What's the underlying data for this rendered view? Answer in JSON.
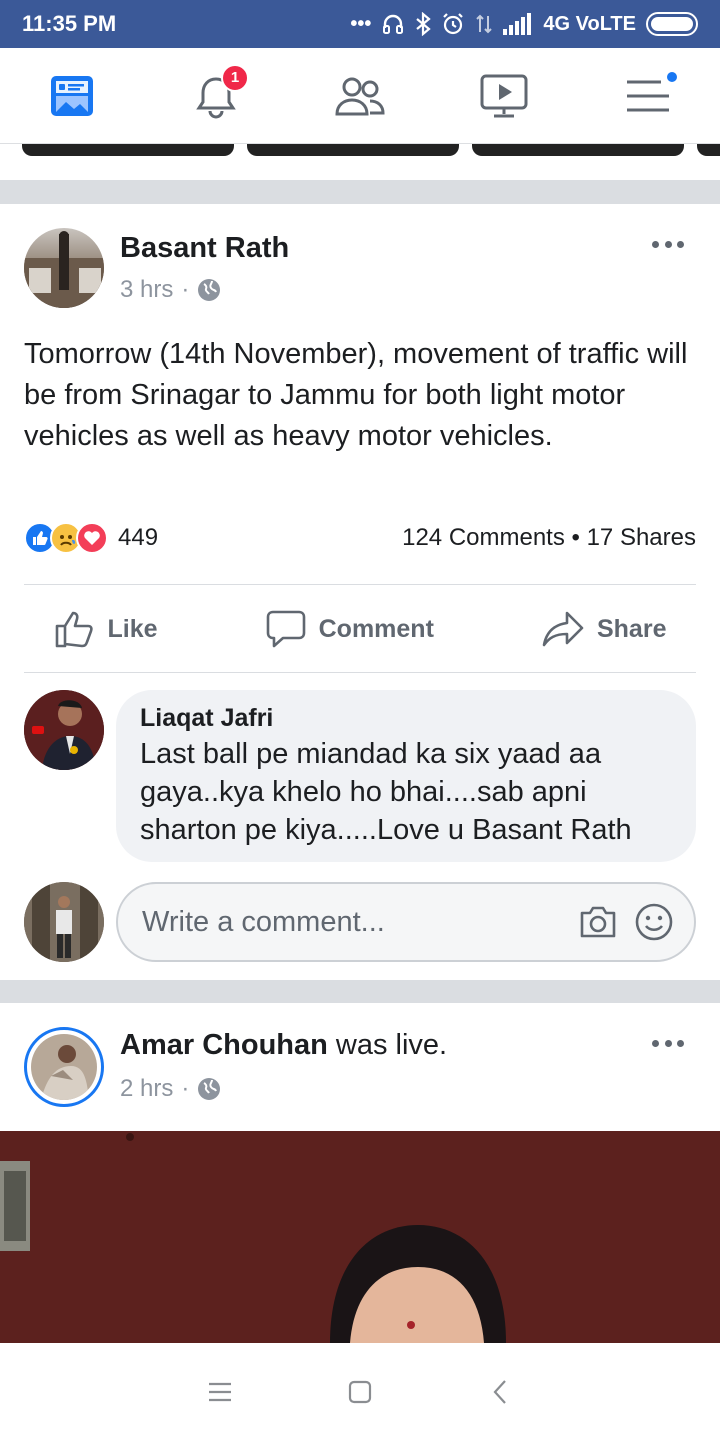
{
  "status_bar": {
    "time": "11:35 PM",
    "network": "4G VoLTE",
    "icons": [
      "more-icon",
      "headphones-icon",
      "bluetooth-icon",
      "alarm-icon",
      "data-icon",
      "signal-icon",
      "battery-icon"
    ]
  },
  "top_nav": {
    "items": [
      {
        "name": "news-feed",
        "icon": "news-feed-icon"
      },
      {
        "name": "notifications",
        "icon": "bell-icon",
        "badge": "1"
      },
      {
        "name": "friends",
        "icon": "friends-icon"
      },
      {
        "name": "watch",
        "icon": "video-icon"
      },
      {
        "name": "menu",
        "icon": "hamburger-icon"
      }
    ]
  },
  "post1": {
    "author": "Basant Rath",
    "time": "3 hrs",
    "separator": "·",
    "privacy_icon": "globe-icon",
    "text": "Tomorrow (14th November), movement of traffic will be  from Srinagar to Jammu for both light motor vehicles as well as heavy motor vehicles.",
    "reactions": {
      "types": [
        "like",
        "sad",
        "love"
      ],
      "count": "449"
    },
    "counts": "124 Comments • 17 Shares",
    "actions": {
      "like": "Like",
      "comment": "Comment",
      "share": "Share"
    },
    "comment": {
      "author": "Liaqat Jafri",
      "text": "Last ball pe miandad ka six yaad aa gaya..kya khelo ho bhai....sab apni sharton pe kiya.....Love u Basant Rath"
    },
    "write_comment_placeholder": "Write a comment..."
  },
  "post2": {
    "author": "Amar Chouhan",
    "action": "was live.",
    "time": "2 hrs",
    "separator": "·",
    "privacy_icon": "globe-icon"
  },
  "colors": {
    "brand": "#3b5998",
    "accent": "#1877f2",
    "badge": "#f02849"
  }
}
